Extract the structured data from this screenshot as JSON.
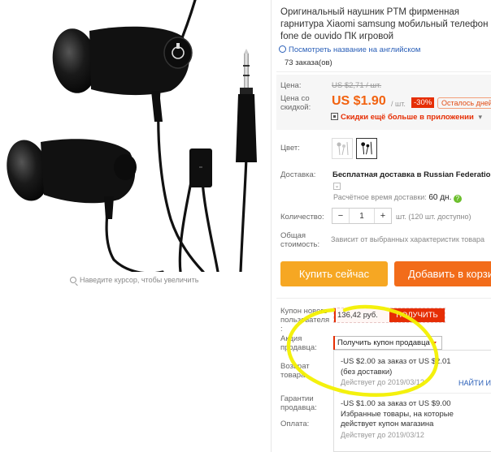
{
  "product": {
    "title": "Оригинальный наушник PTM фирменная гарнитура Xiaomi samsung мобильный телефон fone de ouvido ПК игровой",
    "translate_link": "Посмотреть название на английском",
    "orders": "73 заказа(ов)"
  },
  "gallery": {
    "zoom_hint": "Наведите курсор, чтобы увеличить"
  },
  "price": {
    "label_price": "Цена:",
    "old_price": "US $2,71 / шт.",
    "label_discount": "Цена со скидкой:",
    "current_price": "US $1.90",
    "per_unit": "/ шт.",
    "discount_badge": "-30%",
    "time_left": "Осталось дней",
    "app_discount": "Скидки ещё больше в приложении",
    "app_caret": "▾"
  },
  "color": {
    "label": "Цвет:"
  },
  "shipping": {
    "label": "Доставка:",
    "text": "Бесплатная доставка в Russian Federation с",
    "estimate_label": "Расчётное время доставки:",
    "estimate_value": "60 дн.",
    "expand_glyph": "⌄",
    "help_glyph": "?"
  },
  "quantity": {
    "label": "Количество:",
    "minus": "−",
    "value": "1",
    "plus": "+",
    "available": "шт. (120 шт. доступно)"
  },
  "total": {
    "label": "Общая стоимость:",
    "value": "Зависит от выбранных характеристик товара"
  },
  "actions": {
    "buy_now": "Купить сейчас",
    "add_to_cart": "Добавить в корзину"
  },
  "coupons": {
    "new_user_label": "Купон нового пользователя :",
    "new_user_amount": "136,42 руб.",
    "get_button": "ПОЛУЧИТЬ",
    "seller_promo_label": "Акция продавца:",
    "dropdown_value": "Получить купон продавца",
    "return_label": "Возврат товара",
    "guarantee_label": "Гарантии продавца:",
    "payment_label": "Оплата:",
    "take_all": "НАЙТИ И",
    "items": [
      {
        "line1": "-US $2.00 за заказ от US $2.01",
        "line2": "(без доставки)",
        "date": "Действует до 2019/03/12"
      },
      {
        "line1": "-US $1.00 за заказ от US $9.00",
        "line2": "Избранные товары, на которые",
        "line3": "действует купон магазина",
        "date": "Действует до 2019/03/12"
      }
    ]
  },
  "colors": {
    "accent_orange": "#f26c1a",
    "buy_yellow": "#f6a723",
    "price_orange": "#f2620f",
    "coupon_red": "#e62e04",
    "highlight_yellow": "#f3f000"
  }
}
